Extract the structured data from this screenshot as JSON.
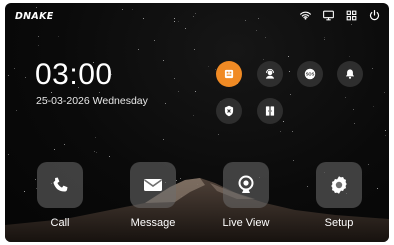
{
  "brand": {
    "logo_text": "DNAKE"
  },
  "status_bar": {
    "icons": [
      "wifi-icon",
      "monitor-icon",
      "grid-icon",
      "power-icon"
    ]
  },
  "clock": {
    "time": "03:00",
    "date": "25-03-2026 Wednesday"
  },
  "quick_buttons": [
    {
      "icon": "building-icon",
      "active": true
    },
    {
      "icon": "support-agent-icon",
      "active": false
    },
    {
      "icon": "sos-icon",
      "label": "SOS",
      "active": false
    },
    {
      "icon": "bell-icon",
      "active": false
    },
    {
      "icon": "shield-x-icon",
      "active": false
    },
    {
      "icon": "door-icon",
      "active": false
    }
  ],
  "dock": [
    {
      "label": "Call",
      "icon": "phone-icon"
    },
    {
      "label": "Message",
      "icon": "mail-icon"
    },
    {
      "label": "Live View",
      "icon": "camera-icon"
    },
    {
      "label": "Setup",
      "icon": "gear-icon"
    }
  ],
  "colors": {
    "accent": "#f08a24",
    "background": "#0a0a0a",
    "button_bg": "#2e2e2e"
  }
}
